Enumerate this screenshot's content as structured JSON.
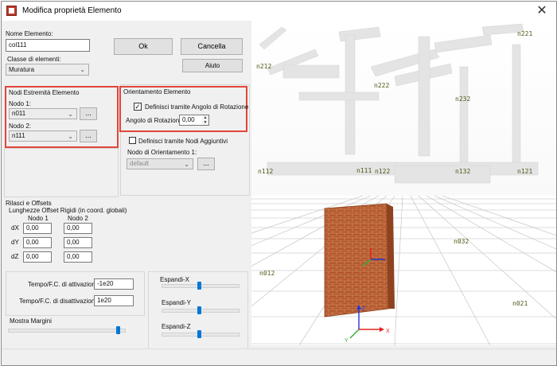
{
  "window": {
    "title": "Modifica proprietà Elemento",
    "close_symbol": "✕"
  },
  "element_name": {
    "label": "Nome Elemento:",
    "value": "col111"
  },
  "element_class": {
    "label": "Classe di elementi:",
    "value": "Muratura"
  },
  "buttons": {
    "ok": "Ok",
    "cancel": "Cancella",
    "help": "Aiuto",
    "ellipsis": "..."
  },
  "end_nodes": {
    "title": "Nodi Estremità Elemento",
    "node1_label": "Nodo 1:",
    "node1_value": "n011",
    "node2_label": "Nodo 2:",
    "node2_value": "n111"
  },
  "orientation": {
    "title": "Orientamento Elemento",
    "by_angle_label": "Definisci tramite Angolo di Rotazione",
    "by_angle_checked": true,
    "angle_label": "Angolo di Rotazione",
    "angle_value": "0,00",
    "by_nodes_label": "Definisci tramite Nodi Aggiuntivi",
    "by_nodes_checked": false,
    "orient_node_label": "Nodo di Orientamento 1:",
    "orient_node_value": "default"
  },
  "releases": {
    "title": "Rilasci e Offsets",
    "subtitle": "Lunghezze Offset Rigidi (in coord. globali)",
    "col1": "Nodo 1",
    "col2": "Nodo 2",
    "rows": [
      {
        "label": "dX",
        "n1": "0,00",
        "n2": "0,00"
      },
      {
        "label": "dY",
        "n1": "0,00",
        "n2": "0,00"
      },
      {
        "label": "dZ",
        "n1": "0,00",
        "n2": "0,00"
      }
    ]
  },
  "times": {
    "activation_label": "Tempo/F.C. di attivazione",
    "activation_value": "-1e20",
    "deactivation_label": "Tempo/F.C. di disattivazione",
    "deactivation_value": "1e20"
  },
  "sliders": {
    "margins_label": "Mostra Margini",
    "margins_level": 0.95,
    "expand_x_label": "Espandi-X",
    "expand_x_level": 0.48,
    "expand_y_label": "Espandi-Y",
    "expand_y_level": 0.48,
    "expand_z_label": "Espandi-Z",
    "expand_z_level": 0.48
  },
  "viewport": {
    "node_labels": [
      "n212",
      "n222",
      "n232",
      "n221",
      "n112",
      "n111",
      "n122",
      "n132",
      "n121",
      "n032",
      "n012",
      "n021"
    ],
    "axis_labels": {
      "x": "X",
      "y": "Y",
      "z": "Z"
    },
    "colors": {
      "wall": "#b4582c",
      "grid": "#bdbdbd",
      "axis_x": "#e0231b",
      "axis_y": "#2fae3a",
      "axis_z": "#2036d6",
      "node_label": "#4f5a1a"
    }
  }
}
